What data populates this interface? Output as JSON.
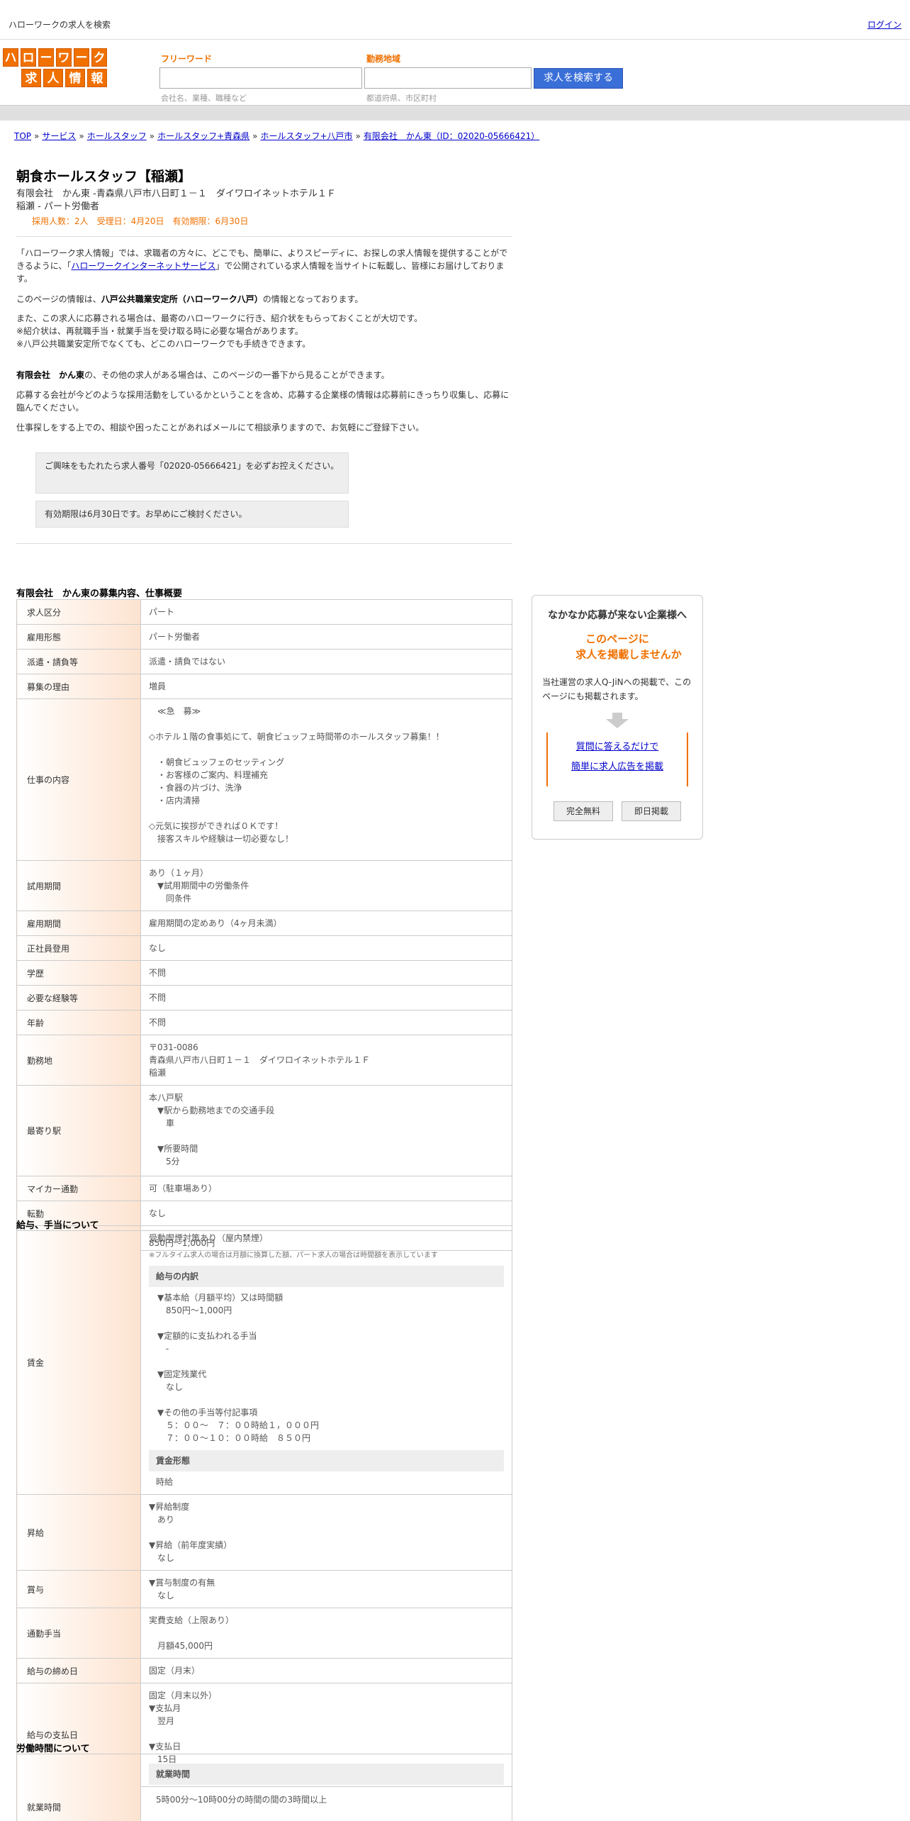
{
  "topbar": {
    "site_title": "ハローワークの求人を検索",
    "login": "ログイン"
  },
  "logo": {
    "row1": [
      "ハ",
      "ロ",
      "ー",
      "ワ",
      "ー",
      "ク"
    ],
    "row2": [
      "求",
      "人",
      "情",
      "報"
    ]
  },
  "search": {
    "freeword_label": "フリーワード",
    "freeword_hint": "会社名、業種、職種など",
    "location_label": "勤務地域",
    "location_hint": "都道府県、市区町村",
    "button": "求人を検索する"
  },
  "breadcrumb": {
    "items": [
      "TOP",
      "サービス",
      "ホールスタッフ",
      "ホールスタッフ+青森県",
      "ホールスタッフ+八戸市",
      "有限会社　かん東（ID：02020-05666421）"
    ],
    "separator": "»"
  },
  "job": {
    "title": "朝食ホールスタッフ【稲瀬】",
    "company_address": "有限会社　かん東 -青森県八戸市八日町１－１　ダイワロイネットホテル１Ｆ",
    "area_type": "稲瀬 - パート労働者",
    "meta": "採用人数：2人　受理日：4月20日　有効期限：6月30日"
  },
  "intro": {
    "p1_a": "「ハローワーク求人情報」では、求職者の方々に、どこでも、簡単に、よりスピーディに、お探しの求人情報を提供することができるように、「",
    "p1_link": "ハローワークインターネットサービス",
    "p1_b": "」で公開されている求人情報を当サイトに転載し、皆様にお届けしております。",
    "p2_a": "このページの情報は、",
    "p2_bold": "八戸公共職業安定所（ハローワーク八戸）",
    "p2_b": "の情報となっております。",
    "p3": "また、この求人に応募される場合は、最寄のハローワークに行き、紹介状をもらっておくことが大切です。",
    "p4": "※紹介状は、再就職手当・就業手当を受け取る時に必要な場合があります。",
    "p5": "※八戸公共職業安定所でなくても、どこのハローワークでも手続きできます。",
    "p6_bold": "有限会社　かん東",
    "p6": "の、その他の求人がある場合は、このページの一番下から見ることができます。",
    "p7": "応募する会社が今どのような採用活動をしているかということを含め、応募する企業様の情報は応募前にきっちり収集し、応募に臨んでください。",
    "p8": "仕事探しをする上での、相談や困ったことがあればメールにて相談承りますので、お気軽にご登録下さい。",
    "box1": "ご興味をもたれたら求人番号「02020-05666421」を必ずお控えください。",
    "box2": "有効期限は6月30日です。お早めにご検討ください。"
  },
  "overview": {
    "title": "有限会社　かん東の募集内容、仕事概要",
    "rows": [
      {
        "label": "求人区分",
        "value": "パート"
      },
      {
        "label": "雇用形態",
        "value": "パート労働者"
      },
      {
        "label": "派遣・請負等",
        "value": "派遣・請負ではない"
      },
      {
        "label": "募集の理由",
        "value": "増員"
      },
      {
        "label": "仕事の内容",
        "value": "　≪急　募≫\n\n◇ホテル１階の食事処にて、朝食ビュッフェ時間帯のホールスタッフ募集！！\n\n　・朝食ビュッフェのセッティング\n　・お客様のご案内、料理補充\n　・食器の片づけ、洗浄\n　・店内清掃\n\n◇元気に挨拶ができれば０Ｋです！\n　接客スキルや経験は一切必要なし！"
      },
      {
        "label": "試用期間",
        "value": "あり（１ヶ月）\n　▼試用期間中の労働条件\n　　同条件"
      },
      {
        "label": "雇用期間",
        "value": "雇用期間の定めあり（4ヶ月未満）"
      },
      {
        "label": "正社員登用",
        "value": "なし"
      },
      {
        "label": "学歴",
        "value": "不問"
      },
      {
        "label": "必要な経験等",
        "value": "不問"
      },
      {
        "label": "年齢",
        "value": "不問"
      },
      {
        "label": "勤務地",
        "value": "〒031-0086\n青森県八戸市八日町１－１　ダイワロイネットホテル１Ｆ\n稲瀬"
      },
      {
        "label": "最寄り駅",
        "value": "本八戸駅\n　▼駅から勤務地までの交通手段\n　　車\n\n　▼所要時間\n　　5分"
      },
      {
        "label": "マイカー通勤",
        "value": "可（駐車場あり）"
      },
      {
        "label": "転勤",
        "value": "なし"
      },
      {
        "label": "受動喫煙対策",
        "value": "受動喫煙対策あり（屋内禁煙）"
      }
    ]
  },
  "salary": {
    "title": "給与、手当について",
    "wage_label": "賃金",
    "wage_range": "850円〜1,000円",
    "wage_note": "※フルタイム求人の場合は月額に換算した額、パート求人の場合は時間額を表示しています",
    "breakdown_head": "給与の内訳",
    "breakdown": "　▼基本給（月額平均）又は時間額\n　　850円〜1,000円\n\n　▼定額的に支払われる手当\n　　-\n\n　▼固定残業代\n　　なし\n\n　▼その他の手当等付記事項\n　　５：００～　７：００時給１，０００円\n　　７：００～１０：００時給　８５０円",
    "form_head": "賃金形態",
    "form": "時給",
    "rows": [
      {
        "label": "昇給",
        "value": "▼昇給制度\n　あり\n\n▼昇給（前年度実績）\n　なし"
      },
      {
        "label": "賞与",
        "value": "▼賞与制度の有無\n　なし"
      },
      {
        "label": "通勤手当",
        "value": "実費支給（上限あり）\n\n　月額45,000円"
      },
      {
        "label": "給与の締め日",
        "value": "固定（月末）"
      },
      {
        "label": "給与の支払日",
        "value": "固定（月末以外）\n▼支払月\n　翌月\n\n▼支払日\n　15日"
      }
    ]
  },
  "hours": {
    "title": "労働時間について",
    "label": "就業時間",
    "sub_head": "就業時間",
    "value": "5時00分〜10時00分の時間の間の3時間以上"
  },
  "sidebar": {
    "title": "なかなか応募が来ない企業様へ",
    "catch1": "このページに",
    "catch2": "求人を掲載しませんか",
    "desc": "当社運営の求人Q-JiNへの掲載で、このページにも掲載されます。",
    "link1": "質問に答えるだけで",
    "link2": "簡単に求人広告を掲載",
    "tag1": "完全無料",
    "tag2": "即日掲載"
  }
}
